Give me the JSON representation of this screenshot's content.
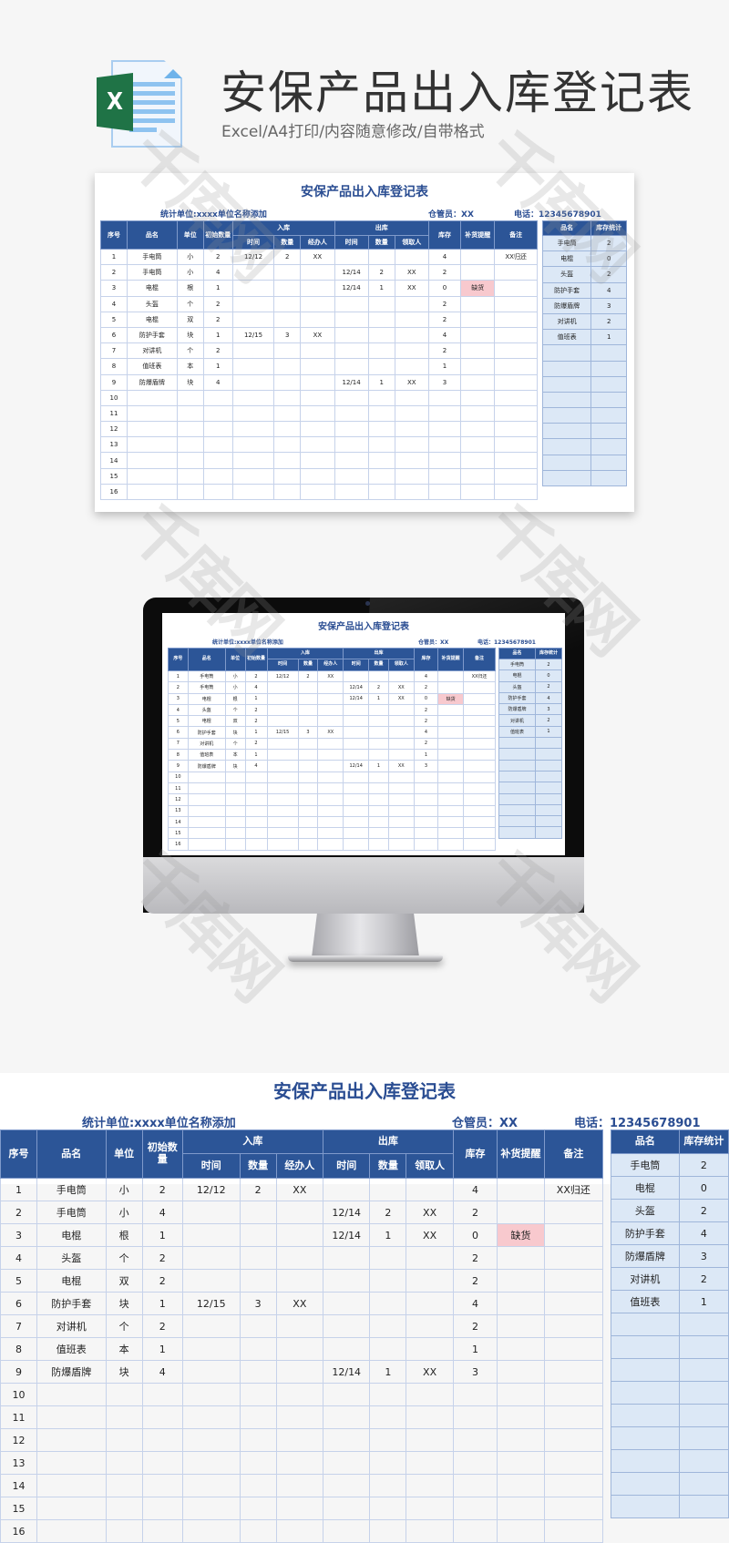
{
  "header": {
    "file_type_badge": "X",
    "title": "安保产品出入库登记表",
    "subtitle": "Excel/A4打印/内容随意修改/自带格式"
  },
  "sheet": {
    "title": "安保产品出入库登记表",
    "unit_label": "统计单位:xxxx单位名称添加",
    "keeper_label": "仓管员：XX",
    "phone_label": "电话：12345678901",
    "columns": {
      "seq": "序号",
      "name": "品名",
      "unit": "单位",
      "initial_qty": "初始数量",
      "in_group": "入库",
      "in_time": "时间",
      "in_qty": "数量",
      "in_handler": "经办人",
      "out_group": "出库",
      "out_time": "时间",
      "out_qty": "数量",
      "out_receiver": "领取人",
      "stock": "库存",
      "restock_alert": "补货提醒",
      "remark": "备注"
    },
    "rows": [
      {
        "seq": "1",
        "name": "手电筒",
        "unit": "小",
        "initial": "2",
        "in_time": "12/12",
        "in_qty": "2",
        "in_handler": "XX",
        "out_time": "",
        "out_qty": "",
        "out_receiver": "",
        "stock": "4",
        "alert": "",
        "remark": "XX归还"
      },
      {
        "seq": "2",
        "name": "手电筒",
        "unit": "小",
        "initial": "4",
        "in_time": "",
        "in_qty": "",
        "in_handler": "",
        "out_time": "12/14",
        "out_qty": "2",
        "out_receiver": "XX",
        "stock": "2",
        "alert": "",
        "remark": ""
      },
      {
        "seq": "3",
        "name": "电棍",
        "unit": "根",
        "initial": "1",
        "in_time": "",
        "in_qty": "",
        "in_handler": "",
        "out_time": "12/14",
        "out_qty": "1",
        "out_receiver": "XX",
        "stock": "0",
        "alert": "缺货",
        "remark": ""
      },
      {
        "seq": "4",
        "name": "头盔",
        "unit": "个",
        "initial": "2",
        "in_time": "",
        "in_qty": "",
        "in_handler": "",
        "out_time": "",
        "out_qty": "",
        "out_receiver": "",
        "stock": "2",
        "alert": "",
        "remark": ""
      },
      {
        "seq": "5",
        "name": "电棍",
        "unit": "双",
        "initial": "2",
        "in_time": "",
        "in_qty": "",
        "in_handler": "",
        "out_time": "",
        "out_qty": "",
        "out_receiver": "",
        "stock": "2",
        "alert": "",
        "remark": ""
      },
      {
        "seq": "6",
        "name": "防护手套",
        "unit": "块",
        "initial": "1",
        "in_time": "12/15",
        "in_qty": "3",
        "in_handler": "XX",
        "out_time": "",
        "out_qty": "",
        "out_receiver": "",
        "stock": "4",
        "alert": "",
        "remark": ""
      },
      {
        "seq": "7",
        "name": "对讲机",
        "unit": "个",
        "initial": "2",
        "in_time": "",
        "in_qty": "",
        "in_handler": "",
        "out_time": "",
        "out_qty": "",
        "out_receiver": "",
        "stock": "2",
        "alert": "",
        "remark": ""
      },
      {
        "seq": "8",
        "name": "值班表",
        "unit": "本",
        "initial": "1",
        "in_time": "",
        "in_qty": "",
        "in_handler": "",
        "out_time": "",
        "out_qty": "",
        "out_receiver": "",
        "stock": "1",
        "alert": "",
        "remark": ""
      },
      {
        "seq": "9",
        "name": "防爆盾牌",
        "unit": "块",
        "initial": "4",
        "in_time": "",
        "in_qty": "",
        "in_handler": "",
        "out_time": "12/14",
        "out_qty": "1",
        "out_receiver": "XX",
        "stock": "3",
        "alert": "",
        "remark": ""
      },
      {
        "seq": "10",
        "name": "",
        "unit": "",
        "initial": "",
        "in_time": "",
        "in_qty": "",
        "in_handler": "",
        "out_time": "",
        "out_qty": "",
        "out_receiver": "",
        "stock": "",
        "alert": "",
        "remark": ""
      },
      {
        "seq": "11",
        "name": "",
        "unit": "",
        "initial": "",
        "in_time": "",
        "in_qty": "",
        "in_handler": "",
        "out_time": "",
        "out_qty": "",
        "out_receiver": "",
        "stock": "",
        "alert": "",
        "remark": ""
      },
      {
        "seq": "12",
        "name": "",
        "unit": "",
        "initial": "",
        "in_time": "",
        "in_qty": "",
        "in_handler": "",
        "out_time": "",
        "out_qty": "",
        "out_receiver": "",
        "stock": "",
        "alert": "",
        "remark": ""
      },
      {
        "seq": "13",
        "name": "",
        "unit": "",
        "initial": "",
        "in_time": "",
        "in_qty": "",
        "in_handler": "",
        "out_time": "",
        "out_qty": "",
        "out_receiver": "",
        "stock": "",
        "alert": "",
        "remark": ""
      },
      {
        "seq": "14",
        "name": "",
        "unit": "",
        "initial": "",
        "in_time": "",
        "in_qty": "",
        "in_handler": "",
        "out_time": "",
        "out_qty": "",
        "out_receiver": "",
        "stock": "",
        "alert": "",
        "remark": ""
      },
      {
        "seq": "15",
        "name": "",
        "unit": "",
        "initial": "",
        "in_time": "",
        "in_qty": "",
        "in_handler": "",
        "out_time": "",
        "out_qty": "",
        "out_receiver": "",
        "stock": "",
        "alert": "",
        "remark": ""
      },
      {
        "seq": "16",
        "name": "",
        "unit": "",
        "initial": "",
        "in_time": "",
        "in_qty": "",
        "in_handler": "",
        "out_time": "",
        "out_qty": "",
        "out_receiver": "",
        "stock": "",
        "alert": "",
        "remark": ""
      }
    ],
    "summary": {
      "col_name": "品名",
      "col_stock": "库存统计",
      "rows": [
        {
          "name": "手电筒",
          "stock": "2"
        },
        {
          "name": "电棍",
          "stock": "0"
        },
        {
          "name": "头盔",
          "stock": "2"
        },
        {
          "name": "防护手套",
          "stock": "4"
        },
        {
          "name": "防爆盾牌",
          "stock": "3"
        },
        {
          "name": "对讲机",
          "stock": "2"
        },
        {
          "name": "值班表",
          "stock": "1"
        },
        {
          "name": "",
          "stock": ""
        },
        {
          "name": "",
          "stock": ""
        },
        {
          "name": "",
          "stock": ""
        },
        {
          "name": "",
          "stock": ""
        },
        {
          "name": "",
          "stock": ""
        },
        {
          "name": "",
          "stock": ""
        },
        {
          "name": "",
          "stock": ""
        },
        {
          "name": "",
          "stock": ""
        },
        {
          "name": "",
          "stock": ""
        }
      ]
    }
  },
  "watermark_text": "千库网",
  "colors": {
    "header_blue": "#2c5597",
    "title_blue": "#2a4d92",
    "summary_bg": "#dce8f6",
    "alert_bg": "#f8c9ce",
    "alert_text": "#c0001a",
    "excel_green": "#1f7346"
  }
}
